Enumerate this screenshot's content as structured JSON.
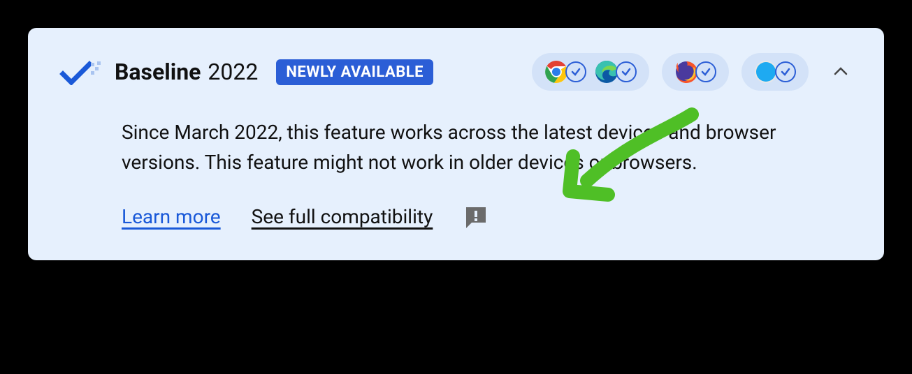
{
  "header": {
    "title_bold": "Baseline",
    "year": "2022",
    "badge": "NEWLY AVAILABLE"
  },
  "browsers": {
    "groups": [
      {
        "items": [
          {
            "name": "chrome"
          },
          {
            "name": "edge"
          }
        ]
      },
      {
        "items": [
          {
            "name": "firefox"
          }
        ]
      },
      {
        "items": [
          {
            "name": "safari"
          }
        ]
      }
    ]
  },
  "description": "Since March 2022, this feature works across the latest devices and browser versions. This feature might not work in older devices or browsers.",
  "links": {
    "learn_more": "Learn more",
    "full_compat": "See full compatibility"
  }
}
